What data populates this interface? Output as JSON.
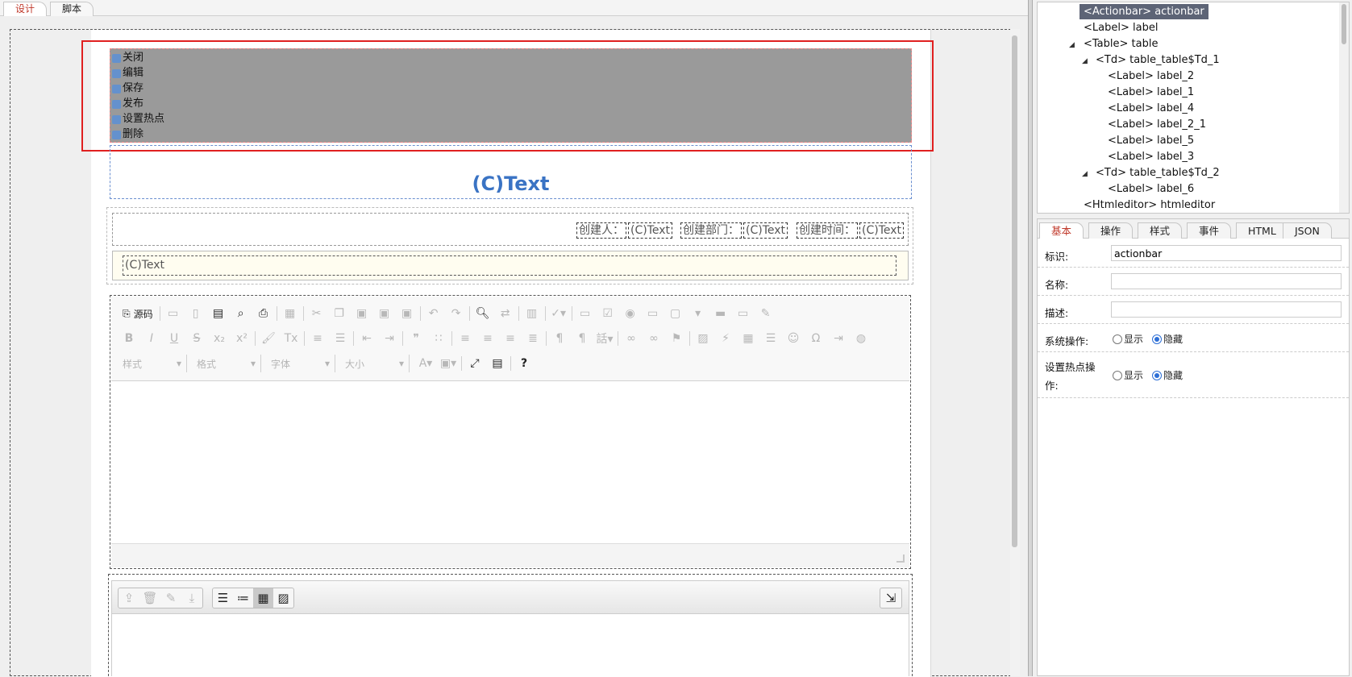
{
  "mode_tabs": [
    "设计",
    "脚本"
  ],
  "actionbar": {
    "buttons": [
      "关闭",
      "编辑",
      "保存",
      "发布",
      "设置热点",
      "删除"
    ]
  },
  "title": {
    "text": "(C)Text"
  },
  "info": {
    "creator_label": "创建人：",
    "creator_value": "(C)Text",
    "dept_label": "创建部门：",
    "dept_value": "(C)Text",
    "time_label": "创建时间：",
    "time_value": "(C)Text",
    "text_value": "(C)Text"
  },
  "editor": {
    "source_label": "源码",
    "combo_style": "样式",
    "combo_format": "格式",
    "combo_font": "字体",
    "combo_size": "大小",
    "help": "?"
  },
  "tree": {
    "nodes": [
      "<Actionbar> actionbar",
      "<Label> label",
      "<Table> table",
      "<Td> table_table$Td_1",
      "<Label> label_2",
      "<Label> label_1",
      "<Label> label_4",
      "<Label> label_2_1",
      "<Label> label_5",
      "<Label> label_3",
      "<Td> table_table$Td_2",
      "<Label> label_6",
      "<Htmleditor> htmleditor"
    ]
  },
  "props": {
    "tabs": [
      "基本",
      "操作",
      "样式",
      "事件",
      "HTML",
      "JSON"
    ],
    "id_label": "标识:",
    "id_value": "actionbar",
    "name_label": "名称:",
    "name_value": "",
    "desc_label": "描述:",
    "desc_value": "",
    "sysop_label": "系统操作:",
    "hotspot_label_1": "设置热点操",
    "hotspot_label_2": "作:",
    "show_label": "显示",
    "hide_label": "隐藏"
  }
}
